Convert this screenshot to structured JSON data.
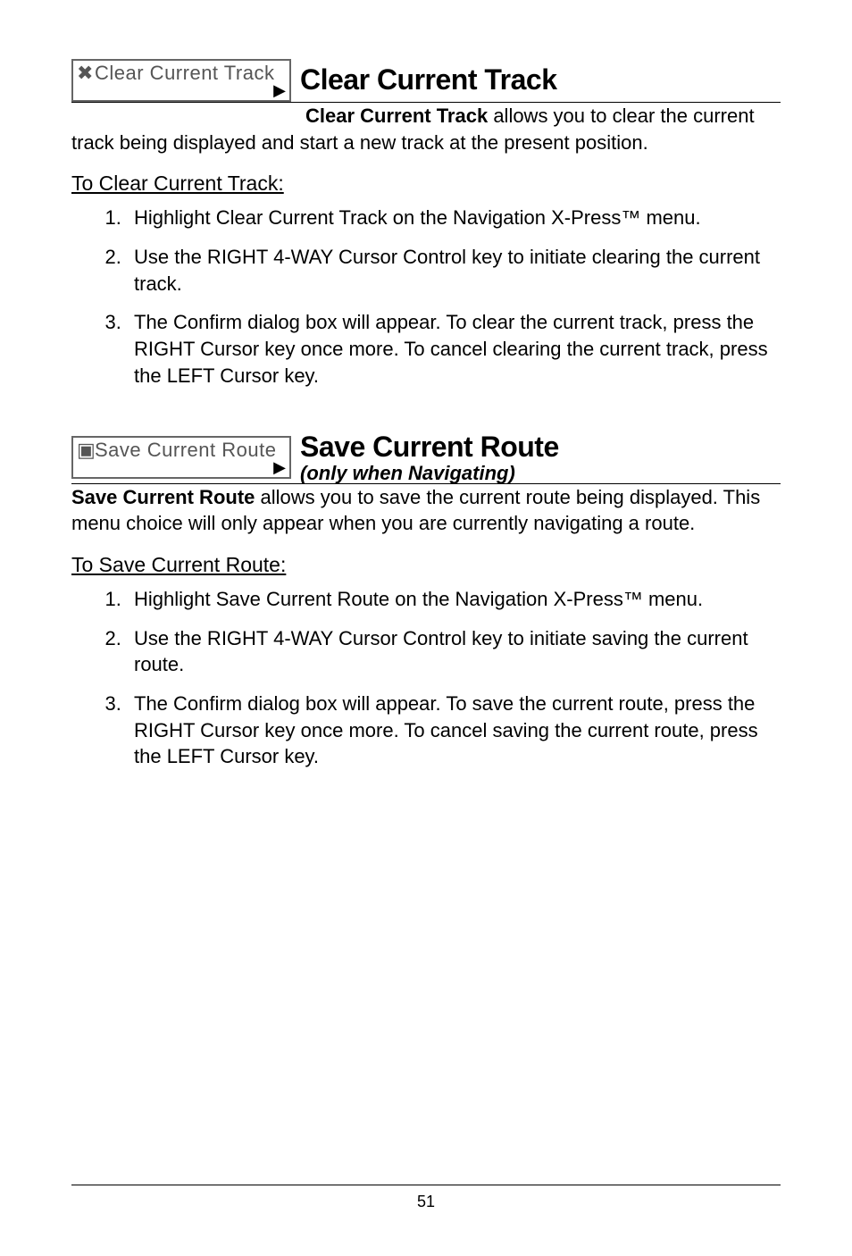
{
  "section1": {
    "menuLabel": "Clear Current Track",
    "menuIcon": "✖",
    "title": "Clear Current Track",
    "leadBold": "Clear Current Track",
    "leadRest": " allows you to clear the current track being displayed and start a new track at the present position.",
    "subheading": "To Clear Current Track:",
    "steps": [
      "Highlight Clear Current Track on the Navigation X-Press™ menu.",
      "Use the RIGHT 4-WAY Cursor Control key to initiate clearing the current track.",
      "The Confirm dialog box will appear. To clear the current track,  press the RIGHT Cursor key once more. To cancel clearing the current track, press the LEFT Cursor key."
    ]
  },
  "section2": {
    "menuLabel": "Save Current Route",
    "menuIcon": "▣",
    "title": "Save Current Route",
    "subtitle": "(only when Navigating)",
    "leadBold": "Save Current Route",
    "leadRest": " allows you to save the current route being displayed. This menu choice will only appear when you are currently navigating a route.",
    "subheading": "To Save Current Route:",
    "steps": [
      "Highlight Save Current Route on the Navigation X-Press™ menu.",
      "Use the RIGHT 4-WAY Cursor Control key to initiate saving the current route.",
      "The Confirm dialog box will appear. To save the current route,  press the RIGHT Cursor key once more. To cancel saving the current route, press the LEFT Cursor key."
    ]
  },
  "pageNumber": "51"
}
